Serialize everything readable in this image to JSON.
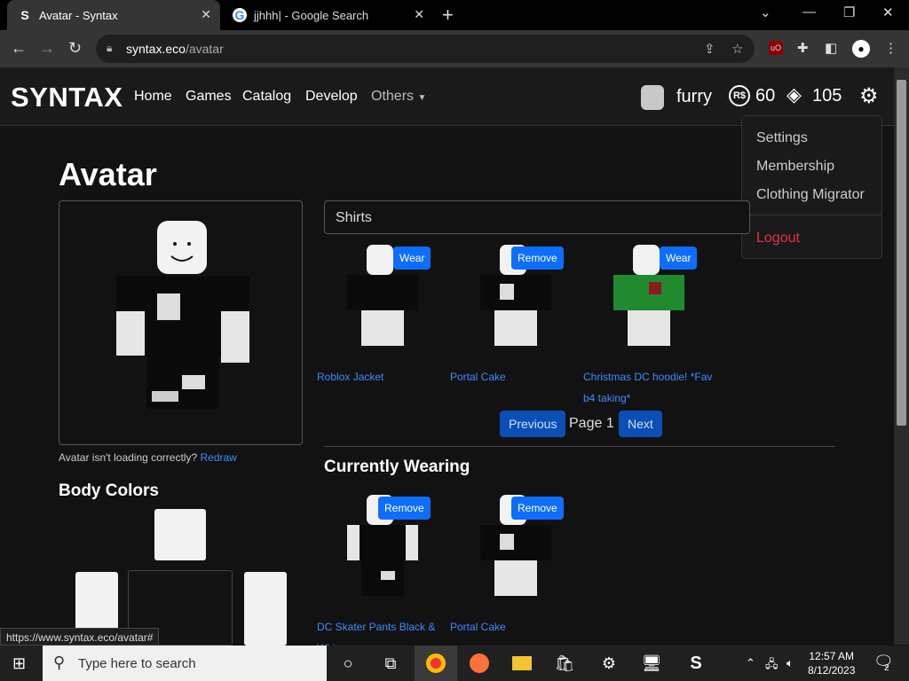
{
  "browser": {
    "tabs": [
      {
        "label": "Avatar - Syntax",
        "favicon": "S"
      },
      {
        "label": "jjhhh| - Google Search",
        "favicon": "G"
      }
    ],
    "url_host": "syntax.eco",
    "url_path": "/avatar"
  },
  "site": {
    "brand": "SYNTAX",
    "nav": [
      "Home",
      "Games",
      "Catalog",
      "Develop",
      "Others"
    ],
    "username": "furry",
    "robux": "60",
    "tix": "105",
    "robux_icon": "R$"
  },
  "dropdown": {
    "items": [
      "Settings",
      "Membership",
      "Clothing Migrator"
    ],
    "logout": "Logout"
  },
  "page": {
    "title": "Avatar",
    "loading_note": "Avatar isn't loading correctly?",
    "redraw": "Redraw",
    "body_colors": "Body Colors",
    "category": "Shirts",
    "currently_wearing": "Currently Wearing"
  },
  "inventory": [
    {
      "name": "Roblox Jacket",
      "action": "Wear"
    },
    {
      "name": "Portal Cake",
      "action": "Remove"
    },
    {
      "name": "Christmas DC hoodie! *Fav b4 taking*",
      "action": "Wear"
    }
  ],
  "pager": {
    "previous": "Previous",
    "page": "Page 1",
    "next": "Next"
  },
  "wearing": [
    {
      "name": "DC Skater Pants Black & Whi",
      "action": "Remove"
    },
    {
      "name": "Portal Cake",
      "action": "Remove"
    }
  ],
  "status_url": "https://www.syntax.eco/avatar#",
  "taskbar": {
    "search_placeholder": "Type here to search",
    "time": "12:57 AM",
    "date": "8/12/2023",
    "notifications": "2"
  }
}
